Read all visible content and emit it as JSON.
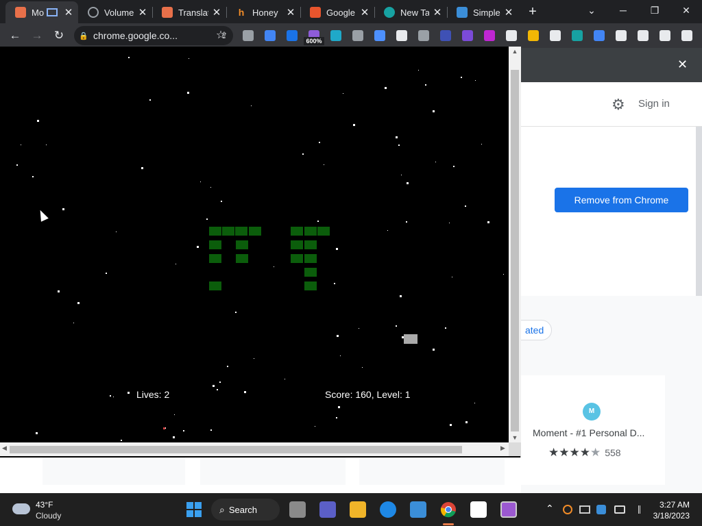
{
  "tabs": [
    {
      "title": "Mo",
      "favicon_color": "#e8704a",
      "active": true
    },
    {
      "title": "Volume",
      "favicon_color": "#9aa0a6"
    },
    {
      "title": "Translat",
      "favicon_color": "#e8704a"
    },
    {
      "title": "Honey",
      "favicon_color": "#f28c28"
    },
    {
      "title": "Google",
      "favicon_color": "#e8552d"
    },
    {
      "title": "New Ta",
      "favicon_color": "#17a2a2"
    },
    {
      "title": "Simple",
      "favicon_color": "#3b8ed8"
    }
  ],
  "tab_close_glyph": "✕",
  "new_tab_glyph": "+",
  "window_controls": {
    "menu": "⌄",
    "minimize": "─",
    "restore": "❐",
    "close": "✕"
  },
  "toolbar": {
    "back_glyph": "←",
    "forward_glyph": "→",
    "reload_glyph": "↻",
    "url": "chrome.google.co...",
    "lock_glyph": "🔒",
    "share_glyph": "⇪",
    "star_glyph": "☆",
    "zoom_badge": "600%",
    "extension_colors": [
      "#9aa0a6",
      "#4285f4",
      "#1a73e8",
      "#8e5cd9",
      "#1fa9c9",
      "#9aa0a6",
      "#4d90fe",
      "#e8eaed",
      "#9aa0a6",
      "#3f51b5",
      "#7b4bd8",
      "#c026d3",
      "#e8eaed",
      "#f2b705",
      "#e8eaed",
      "#17a2a2",
      "#4285f4",
      "#e8eaed",
      "#e8eaed",
      "#e8eaed",
      "#e8eaed"
    ],
    "extensions_glyph": "✱",
    "sidepanel_glyph": "▯",
    "profile_glyph": "●",
    "menu_glyph": "⋮"
  },
  "store": {
    "banner_close": "✕",
    "settings_glyph": "⚙",
    "sign_in": "Sign in",
    "remove_button": "Remove from Chrome",
    "chip_label": "ated",
    "card": {
      "icon_text": "M",
      "name": "Moment - #1 Personal D...",
      "stars": "★★★★",
      "dim_star": "★",
      "rating_count": "558"
    }
  },
  "game": {
    "lives_label": "Lives: 2",
    "score_label": "Score: 160, Level: 1",
    "invader_color": "#0b5d0b",
    "player_color": "#aaaaaa"
  },
  "scroll_arrows": {
    "up": "▲",
    "down": "▼",
    "left": "◀",
    "right": "▶"
  },
  "taskbar": {
    "temperature": "43°F",
    "condition": "Cloudy",
    "search_label": "Search",
    "search_glyph": "⌕",
    "tray_chevron": "⌃",
    "time": "3:27 AM",
    "date": "3/18/2023",
    "app_colors": [
      "#8a8a8a",
      "#5b5fc7",
      "#f0b429",
      "#1e88e5",
      "#3b8ed8",
      "#ffffff",
      "#9b59d0",
      "#2d2d2d"
    ]
  }
}
